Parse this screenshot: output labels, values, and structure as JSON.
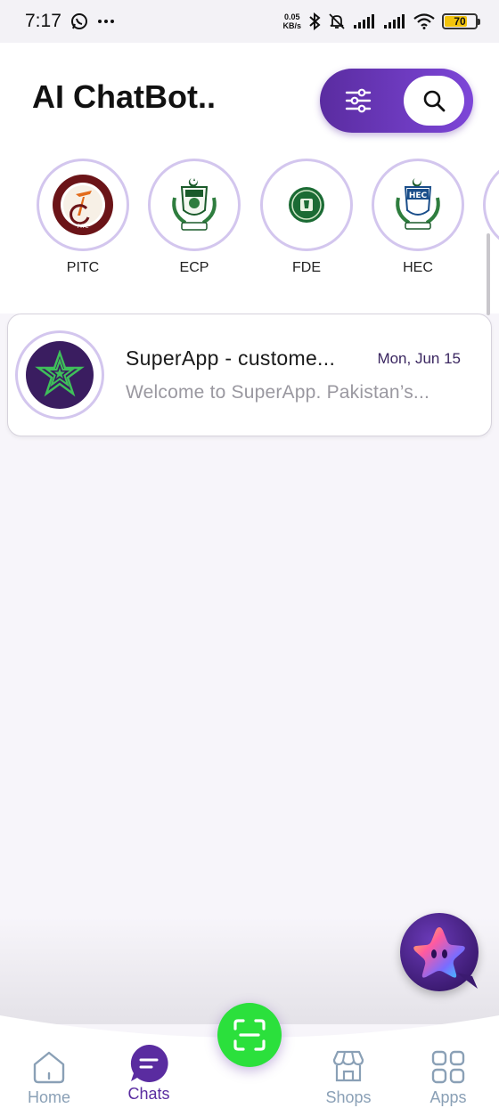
{
  "status_bar": {
    "time": "7:17",
    "speed_value": "0.05",
    "speed_unit": "KB/s",
    "battery": "70",
    "battery_level": 0.7
  },
  "header": {
    "title": "AI ChatBot.."
  },
  "stories": [
    {
      "label": "PITC",
      "icon": "pitc-logo"
    },
    {
      "label": "ECP",
      "icon": "ecp-emblem"
    },
    {
      "label": "FDE",
      "icon": "fde-emblem"
    },
    {
      "label": "HEC",
      "icon": "hec-emblem"
    }
  ],
  "chats": [
    {
      "name": "SuperApp - custome...",
      "date": "Mon, Jun 15",
      "preview": "Welcome to SuperApp. Pakistan’s...",
      "icon": "star-avatar"
    }
  ],
  "bottom_nav": {
    "items": [
      {
        "label": "Home",
        "icon": "home-icon"
      },
      {
        "label": "Chats",
        "icon": "chat-icon",
        "active": true
      },
      {
        "label": "Shops",
        "icon": "shop-icon"
      },
      {
        "label": "Apps",
        "icon": "apps-grid-icon"
      }
    ]
  },
  "colors": {
    "accent": "#5a2ca0",
    "scan_button": "#2be03c",
    "ring": "#d3c6ee",
    "nav_inactive": "#8aa0b6"
  }
}
